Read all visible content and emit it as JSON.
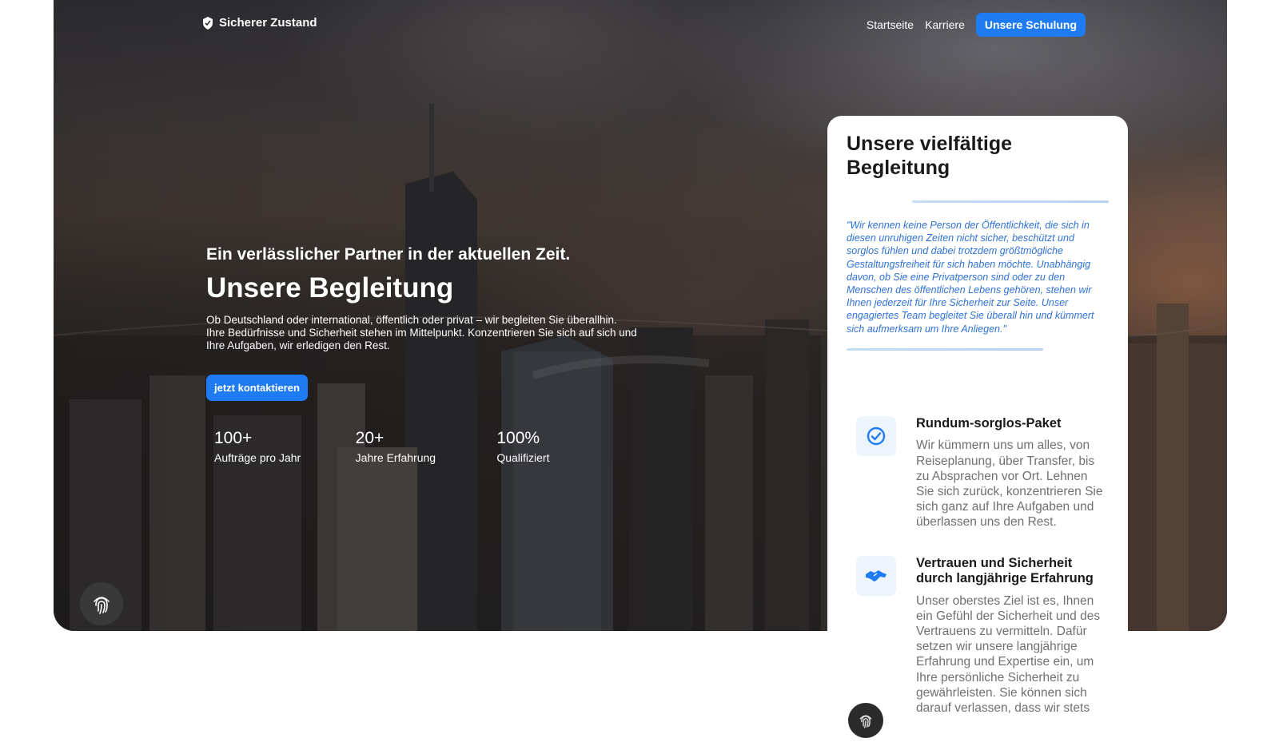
{
  "nav": {
    "brand": "Sicherer Zustand",
    "links": [
      "Startseite",
      "Karriere"
    ],
    "cta": "Unsere Schulung"
  },
  "hero": {
    "eyebrow": "Ein verlässlicher Partner in der aktuellen Zeit.",
    "title": "Unsere Begleitung",
    "description": "Ob Deutschland oder international, öffentlich oder privat – wir begleiten Sie überallhin. Ihre Bedürfnisse und Sicherheit stehen im Mittelpunkt. Konzentrieren Sie sich auf sich und Ihre Aufgaben, wir erledigen den Rest.",
    "contact_button": "jetzt kontaktieren",
    "stats": [
      {
        "value": "100+",
        "label": "Aufträge pro Jahr"
      },
      {
        "value": "20+",
        "label": "Jahre Erfahrung"
      },
      {
        "value": "100%",
        "label": "Qualifiziert"
      }
    ]
  },
  "card": {
    "title_bold": "Unsere",
    "title_rest": " vielfältige Begleitung",
    "quote": "\"Wir kennen keine Person der Öffentlichkeit, die sich in diesen unruhigen Zeiten nicht sicher, beschützt und sorglos fühlen und dabei trotzdem größtmögliche Gestaltungsfreiheit für sich haben möchte. Unabhängig davon, ob Sie eine Privatperson sind oder zu den Menschen des öffentlichen Lebens gehören, stehen wir Ihnen jederzeit für Ihre Sicherheit zur Seite. Unser engagiertes Team begleitet Sie überall hin und kümmert sich aufmerksam um Ihre Anliegen.\"",
    "features": [
      {
        "icon": "check-circle-icon",
        "title": "Rundum-sorglos-Paket",
        "text": "Wir kümmern uns um alles, von Reiseplanung, über Transfer, bis zu Absprachen vor Ort. Lehnen Sie sich zurück, konzentrieren Sie sich ganz auf Ihre Aufgaben und überlassen uns den Rest."
      },
      {
        "icon": "handshake-icon",
        "title": "Vertrauen und Sicherheit durch langjährige Erfahrung",
        "text": "Unser oberstes Ziel ist es, Ihnen ein Gefühl der Sicherheit und des Vertrauens zu vermitteln. Dafür setzen wir unsere langjährige Erfahrung und Expertise ein, um Ihre persönliche Sicherheit zu gewährleisten. Sie können sich darauf verlassen, dass wir stets"
      }
    ]
  },
  "colors": {
    "accent": "#1f7bf2",
    "quote": "#2f72d6",
    "feature_text": "#707070"
  }
}
